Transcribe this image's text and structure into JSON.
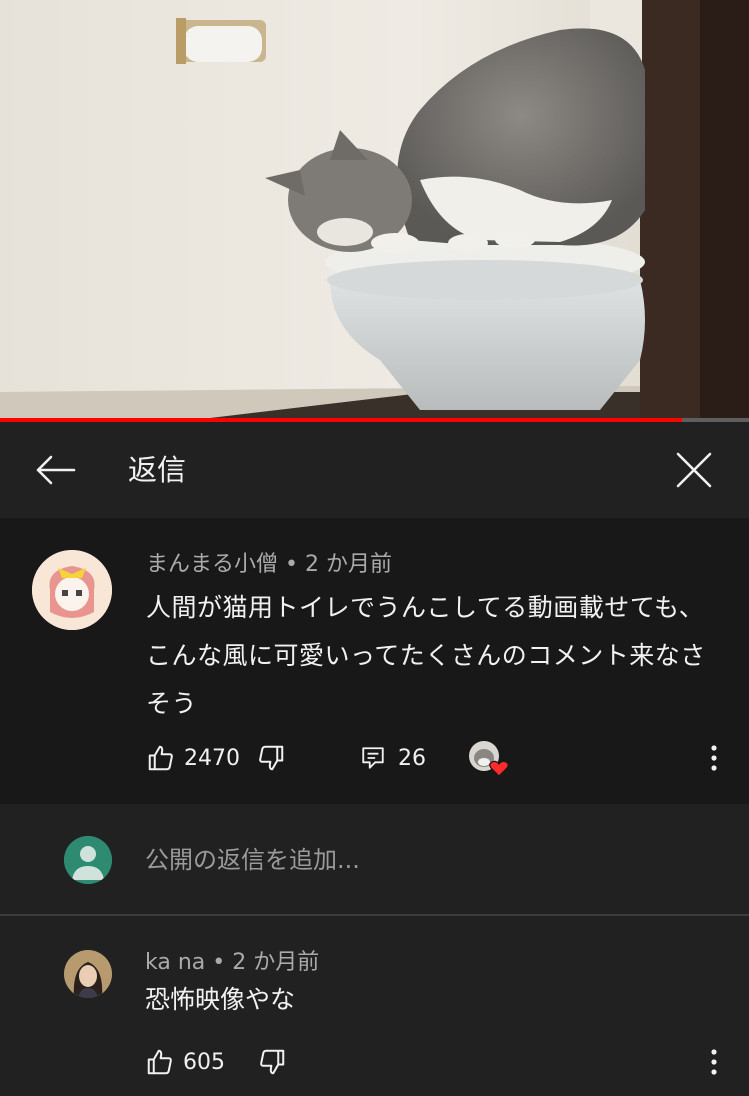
{
  "video": {
    "progress_percent": 91
  },
  "header": {
    "title": "返信",
    "back_icon": "arrow-left-icon",
    "close_icon": "close-icon"
  },
  "main_comment": {
    "author": "まんまる小僧",
    "time": "2 か月前",
    "text": "人間が猫用トイレでうんこしてる動画載せても、こんな風に可愛いってたくさんのコメント来なさそう",
    "likes": "2470",
    "replies": "26",
    "creator_heart": true
  },
  "reply_input": {
    "placeholder": "公開の返信を追加..."
  },
  "replies": [
    {
      "author": "ka na",
      "time": "2 か月前",
      "text": "恐怖映像やな",
      "likes": "605"
    }
  ],
  "separator": "•",
  "colors": {
    "background": "#212121",
    "comment_bg": "#181818",
    "accent_red": "#ff0000",
    "heart": "#ff2a2a",
    "user_avatar": "#2e8b72"
  }
}
